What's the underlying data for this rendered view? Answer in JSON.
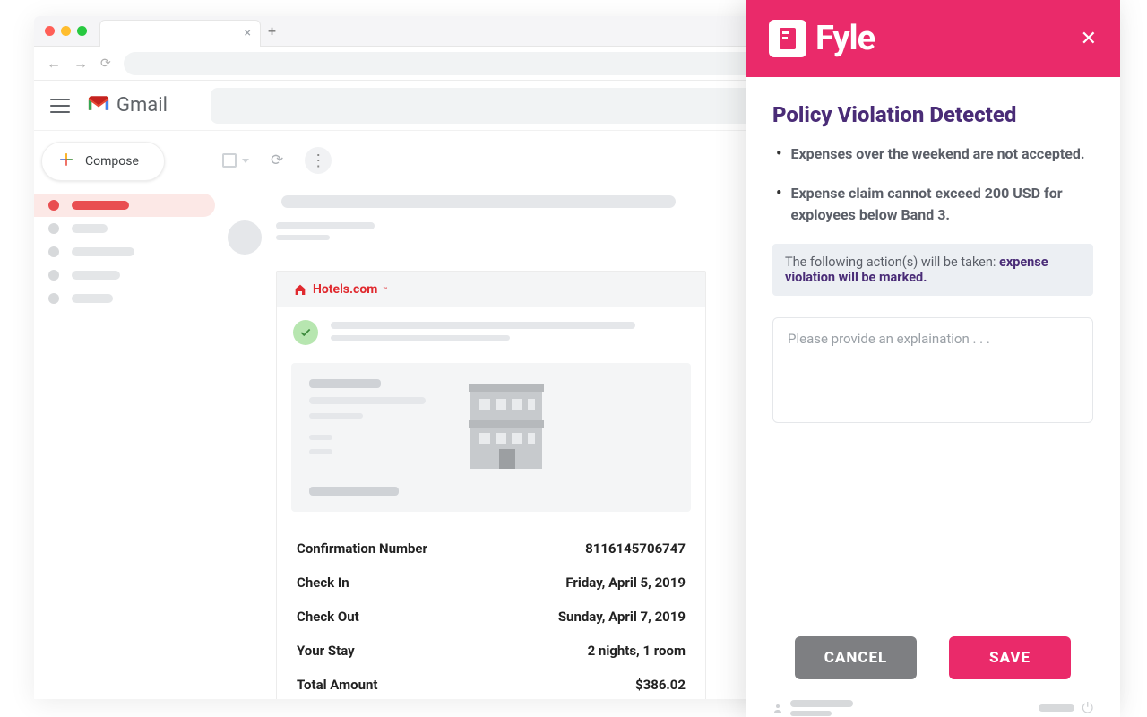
{
  "browser": {
    "tab_close": "×",
    "new_tab": "+"
  },
  "gmail": {
    "brand": "Gmail",
    "compose": "Compose"
  },
  "email": {
    "brand": "Hotels.com",
    "details": [
      {
        "label": "Confirmation Number",
        "value": "8116145706747"
      },
      {
        "label": "Check In",
        "value": "Friday, April 5, 2019"
      },
      {
        "label": "Check Out",
        "value": "Sunday, April 7, 2019"
      },
      {
        "label": "Your Stay",
        "value": "2 nights, 1 room"
      },
      {
        "label": "Total Amount",
        "value": "$386.02"
      }
    ]
  },
  "fyle": {
    "logo_text": "Fyle",
    "title": "Policy Violation Detected",
    "violations": [
      "Expenses over the weekend are not accepted.",
      "Expense claim cannot exceed 200 USD for exployees below Band 3."
    ],
    "action_prefix": "The following action(s) will be taken: ",
    "action_highlight": "expense violation will be marked.",
    "explain_placeholder": "Please provide an explaination . . .",
    "cancel": "CANCEL",
    "save": "SAVE"
  }
}
